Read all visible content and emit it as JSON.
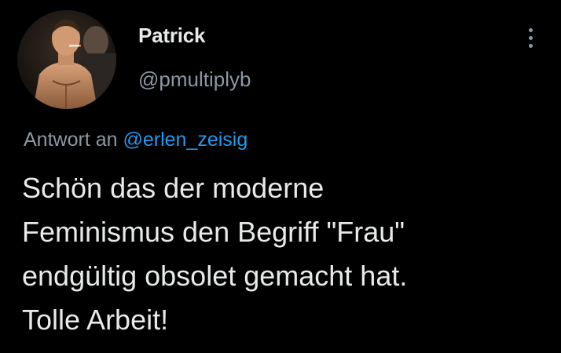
{
  "theme": {
    "background": "#000000",
    "text": "#e7e9ea",
    "muted": "#8b98a5",
    "accent": "#1d9bf0"
  },
  "author": {
    "display_name": "Patrick",
    "handle": "@pmultiplyb",
    "avatar_icon": "profile-photo"
  },
  "more_menu_icon": "vertical-ellipsis-icon",
  "reply": {
    "prefix": "Antwort an",
    "mention": "@erlen_zeisig"
  },
  "tweet": {
    "lines": [
      "Schön das der moderne",
      "Feminismus den Begriff \"Frau\"",
      "endgültig obsolet gemacht hat.",
      "Tolle Arbeit!"
    ]
  }
}
